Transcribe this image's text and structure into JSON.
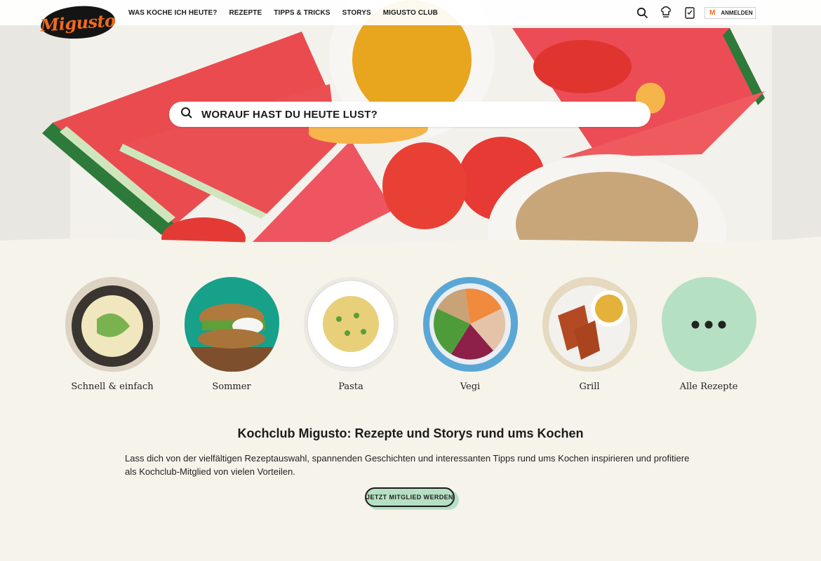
{
  "header": {
    "logo_text": "Migusto",
    "nav": [
      "WAS KOCHE ICH HEUTE?",
      "REZEPTE",
      "TIPPS & TRICKS",
      "STORYS",
      "MIGUSTO CLUB"
    ],
    "icons": [
      "search-icon",
      "chef-hat-icon",
      "shopping-list-icon"
    ],
    "login_badge": "M",
    "login_label": "ANMELDEN"
  },
  "hero": {
    "search_placeholder": "WORAUF HAST DU HEUTE LUST?"
  },
  "categories": [
    {
      "label": "Schnell & einfach"
    },
    {
      "label": "Sommer"
    },
    {
      "label": "Pasta"
    },
    {
      "label": "Vegi"
    },
    {
      "label": "Grill"
    },
    {
      "label": "Alle Rezepte"
    }
  ],
  "intro": {
    "title": "Kochclub Migusto: Rezepte und Storys rund ums Kochen",
    "text": "Lass dich von der vielfältigen Rezeptauswahl, spannenden Geschichten und interessanten Tipps rund ums Kochen inspirieren und profitiere als Kochclub-Mitglied von vielen Vorteilen.",
    "cta": "JETZT MITGLIED WERDEN"
  },
  "colors": {
    "accent_orange": "#f26a1b",
    "blob_orange": "#f6b54b",
    "mint": "#b6e0c3",
    "background": "#f6f3ea"
  }
}
